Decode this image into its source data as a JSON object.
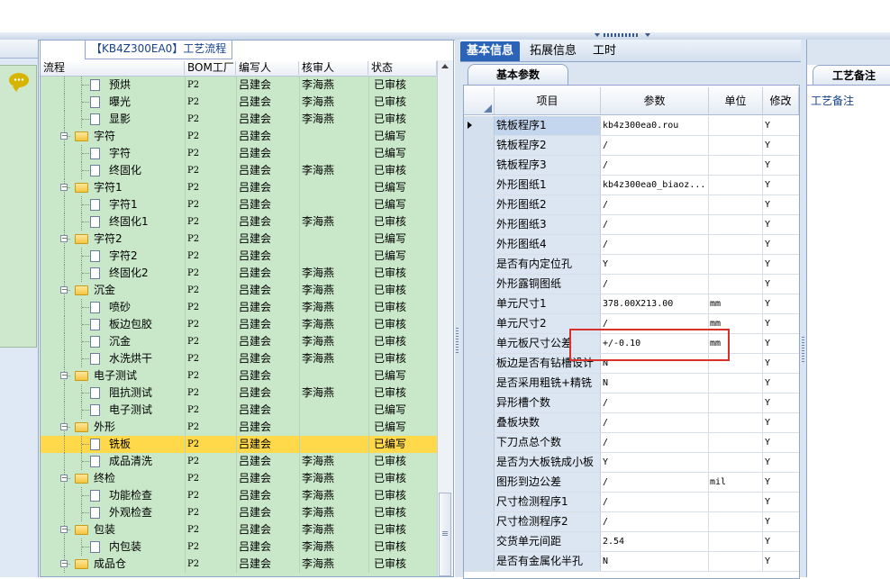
{
  "tree": {
    "title": "【KB4Z300EA0】工艺流程",
    "columns": [
      "流程",
      "BOM工厂",
      "编写人",
      "核审人",
      "状态"
    ],
    "rows": [
      {
        "level": 2,
        "type": "doc",
        "name": "预烘",
        "bom": "P2",
        "writer": "吕建会",
        "reviewer": "李海燕",
        "status": "已审核"
      },
      {
        "level": 2,
        "type": "doc",
        "name": "曝光",
        "bom": "P2",
        "writer": "吕建会",
        "reviewer": "李海燕",
        "status": "已审核"
      },
      {
        "level": 2,
        "type": "doc",
        "name": "显影",
        "bom": "P2",
        "writer": "吕建会",
        "reviewer": "李海燕",
        "status": "已审核"
      },
      {
        "level": 1,
        "type": "folder",
        "name": "字符",
        "bom": "P2",
        "writer": "吕建会",
        "reviewer": "",
        "status": "已编写"
      },
      {
        "level": 2,
        "type": "doc",
        "name": "字符",
        "bom": "P2",
        "writer": "吕建会",
        "reviewer": "",
        "status": "已编写"
      },
      {
        "level": 2,
        "type": "doc",
        "name": "终固化",
        "bom": "P2",
        "writer": "吕建会",
        "reviewer": "李海燕",
        "status": "已审核"
      },
      {
        "level": 1,
        "type": "folder",
        "name": "字符1",
        "bom": "P2",
        "writer": "吕建会",
        "reviewer": "",
        "status": "已编写"
      },
      {
        "level": 2,
        "type": "doc",
        "name": "字符1",
        "bom": "P2",
        "writer": "吕建会",
        "reviewer": "",
        "status": "已编写"
      },
      {
        "level": 2,
        "type": "doc",
        "name": "终固化1",
        "bom": "P2",
        "writer": "吕建会",
        "reviewer": "李海燕",
        "status": "已审核"
      },
      {
        "level": 1,
        "type": "folder",
        "name": "字符2",
        "bom": "P2",
        "writer": "吕建会",
        "reviewer": "",
        "status": "已编写"
      },
      {
        "level": 2,
        "type": "doc",
        "name": "字符2",
        "bom": "P2",
        "writer": "吕建会",
        "reviewer": "",
        "status": "已编写"
      },
      {
        "level": 2,
        "type": "doc",
        "name": "终固化2",
        "bom": "P2",
        "writer": "吕建会",
        "reviewer": "李海燕",
        "status": "已审核"
      },
      {
        "level": 1,
        "type": "folder",
        "name": "沉金",
        "bom": "P2",
        "writer": "吕建会",
        "reviewer": "李海燕",
        "status": "已审核"
      },
      {
        "level": 2,
        "type": "doc",
        "name": "喷砂",
        "bom": "P2",
        "writer": "吕建会",
        "reviewer": "李海燕",
        "status": "已审核"
      },
      {
        "level": 2,
        "type": "doc",
        "name": "板边包胶",
        "bom": "P2",
        "writer": "吕建会",
        "reviewer": "李海燕",
        "status": "已审核"
      },
      {
        "level": 2,
        "type": "doc",
        "name": "沉金",
        "bom": "P2",
        "writer": "吕建会",
        "reviewer": "李海燕",
        "status": "已审核"
      },
      {
        "level": 2,
        "type": "doc",
        "name": "水洗烘干",
        "bom": "P2",
        "writer": "吕建会",
        "reviewer": "李海燕",
        "status": "已审核"
      },
      {
        "level": 1,
        "type": "folder",
        "name": "电子测试",
        "bom": "P2",
        "writer": "吕建会",
        "reviewer": "",
        "status": "已编写"
      },
      {
        "level": 2,
        "type": "doc",
        "name": "阻抗测试",
        "bom": "P2",
        "writer": "吕建会",
        "reviewer": "李海燕",
        "status": "已审核"
      },
      {
        "level": 2,
        "type": "doc",
        "name": "电子测试",
        "bom": "P2",
        "writer": "吕建会",
        "reviewer": "",
        "status": "已编写"
      },
      {
        "level": 1,
        "type": "folder",
        "name": "外形",
        "bom": "P2",
        "writer": "吕建会",
        "reviewer": "",
        "status": "已编写"
      },
      {
        "level": 2,
        "type": "doc",
        "name": "铣板",
        "bom": "P2",
        "writer": "吕建会",
        "reviewer": "",
        "status": "已编写",
        "selected": true
      },
      {
        "level": 2,
        "type": "doc",
        "name": "成品清洗",
        "bom": "P2",
        "writer": "吕建会",
        "reviewer": "李海燕",
        "status": "已审核"
      },
      {
        "level": 1,
        "type": "folder",
        "name": "终检",
        "bom": "P2",
        "writer": "吕建会",
        "reviewer": "李海燕",
        "status": "已审核"
      },
      {
        "level": 2,
        "type": "doc",
        "name": "功能检查",
        "bom": "P2",
        "writer": "吕建会",
        "reviewer": "李海燕",
        "status": "已审核"
      },
      {
        "level": 2,
        "type": "doc",
        "name": "外观检查",
        "bom": "P2",
        "writer": "吕建会",
        "reviewer": "李海燕",
        "status": "已审核"
      },
      {
        "level": 1,
        "type": "folder",
        "name": "包装",
        "bom": "P2",
        "writer": "吕建会",
        "reviewer": "李海燕",
        "status": "已审核"
      },
      {
        "level": 2,
        "type": "doc",
        "name": "内包装",
        "bom": "P2",
        "writer": "吕建会",
        "reviewer": "李海燕",
        "status": "已审核"
      },
      {
        "level": 1,
        "type": "folder",
        "name": "成品仓",
        "bom": "P2",
        "writer": "吕建会",
        "reviewer": "李海燕",
        "status": "已审核"
      }
    ]
  },
  "info": {
    "tabs": [
      "基本信息",
      "拓展信息",
      "工时"
    ],
    "active_tab": 0,
    "subtab": "基本参数",
    "columns": {
      "item": "项目",
      "param": "参数",
      "unit": "单位",
      "modify": "修改"
    },
    "rows": [
      {
        "item": "铣板程序1",
        "param": "kb4z300ea0.rou",
        "unit": "",
        "modify": "Y",
        "current": true
      },
      {
        "item": "铣板程序2",
        "param": "/",
        "unit": "",
        "modify": "Y"
      },
      {
        "item": "铣板程序3",
        "param": "/",
        "unit": "",
        "modify": "Y"
      },
      {
        "item": "外形图纸1",
        "param": "kb4z300ea0_biaoz...",
        "unit": "",
        "modify": "Y"
      },
      {
        "item": "外形图纸2",
        "param": "/",
        "unit": "",
        "modify": "Y"
      },
      {
        "item": "外形图纸3",
        "param": "/",
        "unit": "",
        "modify": "Y"
      },
      {
        "item": "外形图纸4",
        "param": "/",
        "unit": "",
        "modify": "Y"
      },
      {
        "item": "是否有内定位孔",
        "param": "Y",
        "unit": "",
        "modify": "Y"
      },
      {
        "item": "外形露铜图纸",
        "param": "/",
        "unit": "",
        "modify": "Y"
      },
      {
        "item": "单元尺寸1",
        "param": "378.00X213.00",
        "unit": "mm",
        "modify": "Y"
      },
      {
        "item": "单元尺寸2",
        "param": "/",
        "unit": "mm",
        "modify": "Y"
      },
      {
        "item": "单元板尺寸公差",
        "param": "+/-0.10",
        "unit": "mm",
        "modify": "Y"
      },
      {
        "item": "板边是否有钻槽设计",
        "param": "N",
        "unit": "",
        "modify": "Y"
      },
      {
        "item": "是否采用粗铣+精铣",
        "param": "N",
        "unit": "",
        "modify": "Y"
      },
      {
        "item": "异形槽个数",
        "param": "/",
        "unit": "",
        "modify": "Y"
      },
      {
        "item": "叠板块数",
        "param": "/",
        "unit": "",
        "modify": "Y"
      },
      {
        "item": "下刀点总个数",
        "param": "/",
        "unit": "",
        "modify": "Y"
      },
      {
        "item": "是否为大板铣成小板",
        "param": "Y",
        "unit": "",
        "modify": "Y"
      },
      {
        "item": "图形到边公差",
        "param": "/",
        "unit": "mil",
        "modify": "Y"
      },
      {
        "item": "尺寸检测程序1",
        "param": "/",
        "unit": "",
        "modify": "Y"
      },
      {
        "item": "尺寸检测程序2",
        "param": "/",
        "unit": "",
        "modify": "Y"
      },
      {
        "item": "交货单元间距",
        "param": "2.54",
        "unit": "",
        "modify": "Y"
      },
      {
        "item": "是否有金属化半孔",
        "param": "N",
        "unit": "",
        "modify": "Y"
      }
    ]
  },
  "notes": {
    "tab": "工艺备注",
    "label": "工艺备注"
  },
  "colors": {
    "tree_bg": "#c9e7c9",
    "selected_row": "#ffd94a",
    "active_tab": "#2a63b8",
    "highlight_box": "#d9302a"
  }
}
